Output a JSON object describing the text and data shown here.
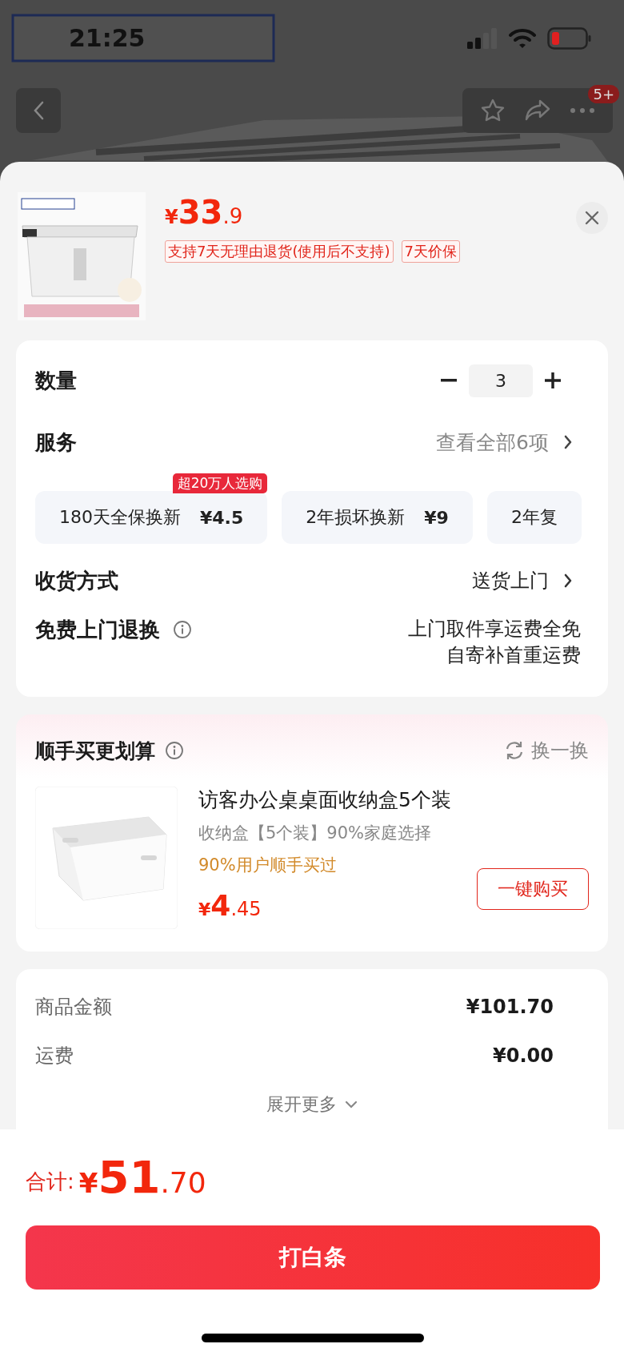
{
  "status_bar": {
    "time": "21:25"
  },
  "nav": {
    "badge": "5+"
  },
  "product": {
    "price": {
      "symbol": "¥",
      "integer": "33",
      "decimal": ".9"
    },
    "tags": [
      "支持7天无理由退货(使用后不支持)",
      "7天价保"
    ]
  },
  "quantity": {
    "label": "数量",
    "value": "3"
  },
  "service": {
    "label": "服务",
    "link": "查看全部6项",
    "options": [
      {
        "name": "180天全保换新",
        "price": "¥4.5",
        "badge": "超20万人选购"
      },
      {
        "name": "2年损坏换新",
        "price": "¥9"
      },
      {
        "name": "2年复"
      }
    ]
  },
  "delivery": {
    "label": "收货方式",
    "value": "送货上门"
  },
  "free_return": {
    "label": "免费上门退换",
    "lines": [
      "上门取件享运费全免",
      "自寄补首重运费"
    ]
  },
  "addon": {
    "title": "顺手买更划算",
    "refresh": "换一换",
    "item": {
      "title": "访客办公桌桌面收纳盒5个装",
      "subtitle": "收纳盒【5个装】90%家庭选择",
      "note": "90%用户顺手买过",
      "price": {
        "symbol": "¥",
        "integer": "4",
        "decimal": ".45"
      },
      "button": "一键购买"
    }
  },
  "summary": {
    "rows": [
      {
        "label": "商品金额",
        "value": "¥101.70"
      },
      {
        "label": "运费",
        "value": "¥0.00"
      }
    ],
    "expand": "展开更多"
  },
  "footer": {
    "total_label": "合计:",
    "price": {
      "symbol": "¥",
      "integer": "51",
      "decimal": ".70"
    },
    "button": "打白条"
  }
}
